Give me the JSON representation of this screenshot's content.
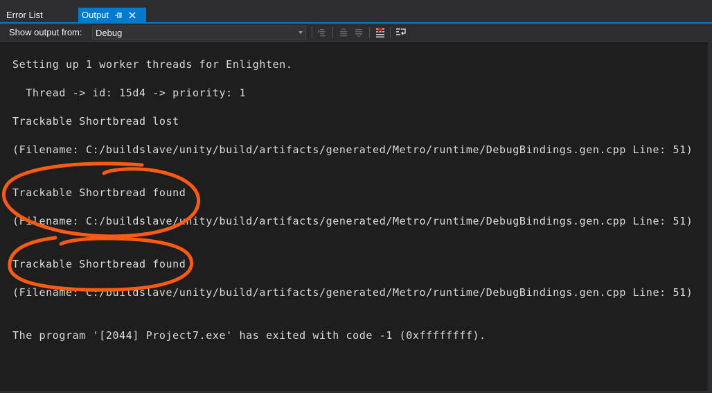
{
  "tabs": [
    {
      "label": "Error List",
      "active": false
    },
    {
      "label": "Output",
      "active": true,
      "pin_icon": "pin-icon",
      "close_icon": "close-icon"
    }
  ],
  "toolbar": {
    "show_output_label": "Show output from:",
    "source_selected": "Debug",
    "buttons": [
      {
        "icon": "find-message-in-code-icon"
      },
      {
        "icon": "go-to-previous-message-icon"
      },
      {
        "icon": "go-to-next-message-icon"
      },
      {
        "icon": "clear-all-icon"
      },
      {
        "icon": "toggle-word-wrap-icon"
      }
    ]
  },
  "output": {
    "lines": [
      "Setting up 1 worker threads for Enlighten.",
      "  Thread -> id: 15d4 -> priority: 1",
      "Trackable Shortbread lost",
      "(Filename: C:/buildslave/unity/build/artifacts/generated/Metro/runtime/DebugBindings.gen.cpp Line: 51)",
      "Trackable Shortbread found",
      "(Filename: C:/buildslave/unity/build/artifacts/generated/Metro/runtime/DebugBindings.gen.cpp Line: 51)",
      "Trackable Shortbread found",
      "(Filename: C:/buildslave/unity/build/artifacts/generated/Metro/runtime/DebugBindings.gen.cpp Line: 51)",
      "The program '[2044] Project7.exe' has exited with code -1 (0xffffffff)."
    ]
  },
  "colors": {
    "tab_active": "#007acc",
    "background": "#1e1e1e",
    "chrome": "#2d2d30",
    "annotation": "#ff5a14",
    "clear_icon_accent": "#e51400"
  }
}
